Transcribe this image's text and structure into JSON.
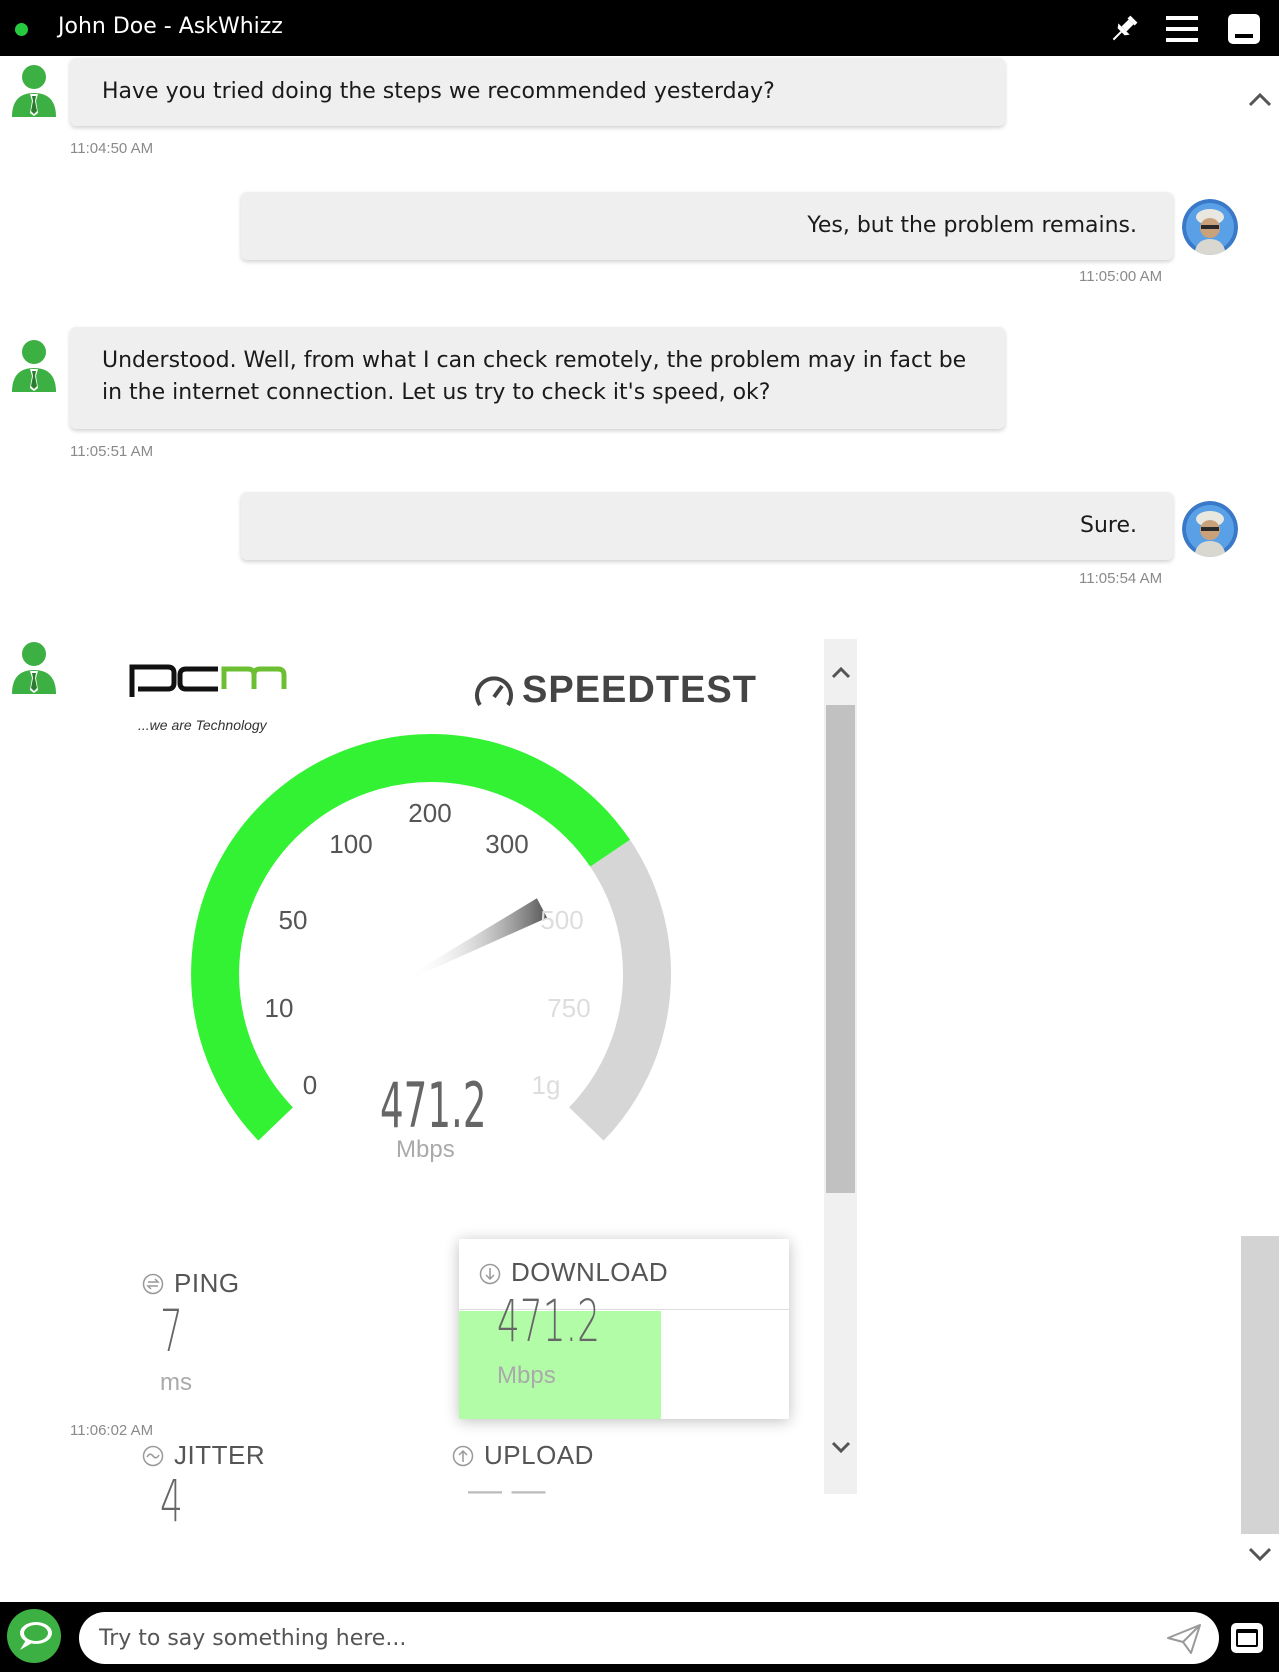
{
  "window": {
    "title": "John Doe - AskWhizz",
    "status_color": "#27c93f"
  },
  "messages": [
    {
      "from": "agent",
      "text": "Have you tried doing the steps we recommended yesterday?",
      "time": "11:04:50 AM"
    },
    {
      "from": "user",
      "text": "Yes, but the problem remains.",
      "time": "11:05:00 AM"
    },
    {
      "from": "agent",
      "text": "Understood. Well, from what I can check remotely, the problem may in fact be in the internet connection. Let us try to check it's speed, ok?",
      "time": "11:05:51 AM"
    },
    {
      "from": "user",
      "text": "Sure.",
      "time": "11:05:54 AM"
    },
    {
      "from": "agent",
      "widget": "speedtest",
      "time": "11:06:02 AM"
    }
  ],
  "speedtest": {
    "logo_text": "pcm",
    "logo_tagline": "...we are Technology",
    "brand": "SPEEDTEST",
    "gauge": {
      "ticks": [
        "0",
        "10",
        "50",
        "100",
        "200",
        "300",
        "500",
        "750",
        "1g"
      ],
      "value": "471.2",
      "unit": "Mbps",
      "active_color": "#33f233",
      "inactive_color": "#d6d6d6"
    },
    "ping": {
      "label": "PING",
      "value": "7",
      "unit": "ms"
    },
    "jitter": {
      "label": "JITTER",
      "value": "4"
    },
    "download": {
      "label": "DOWNLOAD",
      "value": "471.2",
      "unit": "Mbps",
      "fill_color": "#b2fca8"
    },
    "upload": {
      "label": "UPLOAD",
      "value": "— —"
    }
  },
  "input": {
    "placeholder": "Try to say something here..."
  },
  "icons": {
    "pin": "pin-icon",
    "menu": "menu-icon",
    "minimize": "minimize-icon",
    "send": "send-icon",
    "expand": "expand-icon"
  }
}
